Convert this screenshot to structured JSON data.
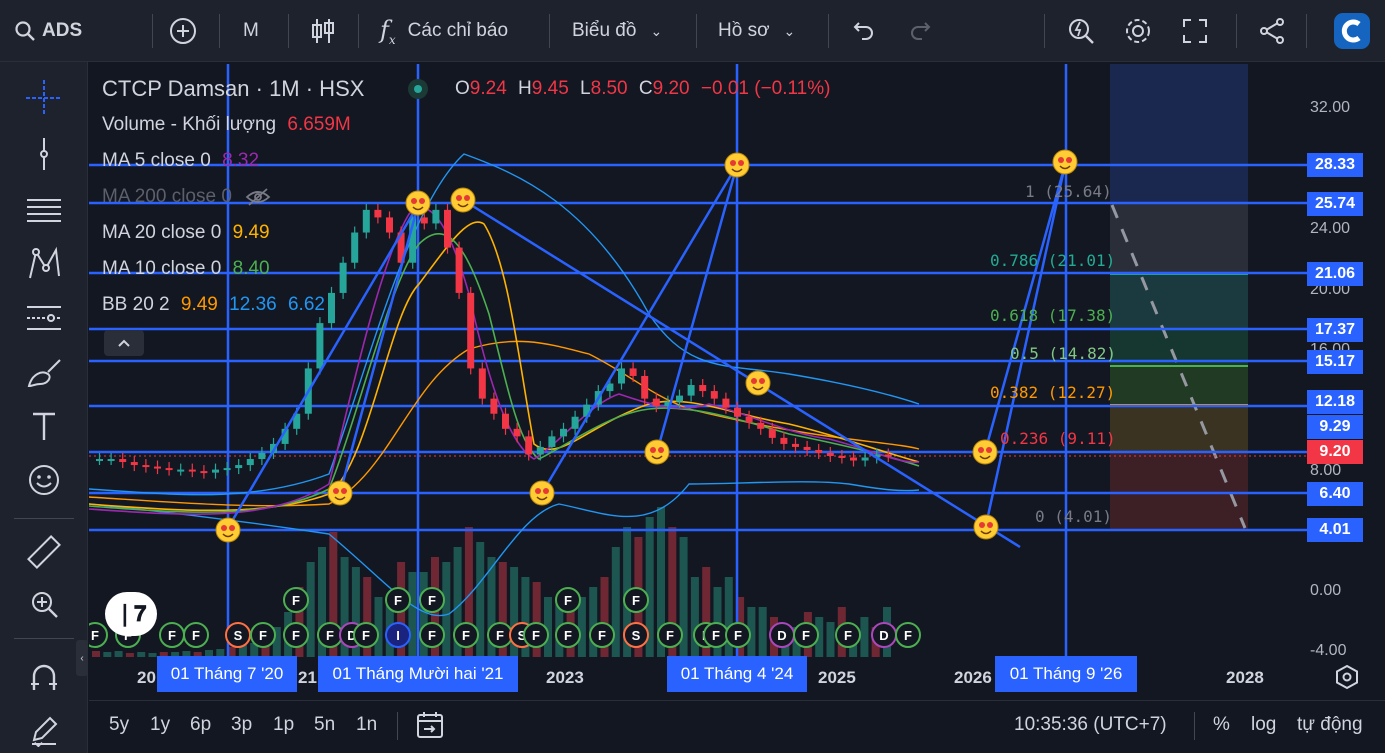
{
  "toolbar": {
    "symbol": "ADS",
    "interval": "M",
    "indicators_label": "Các chỉ báo",
    "chart_type_label": "Biểu đồ",
    "profile_label": "Hồ sơ"
  },
  "legend": {
    "title": "CTCP Damsan · 1M · HSX",
    "o_label": "O",
    "o": "9.24",
    "h_label": "H",
    "h": "9.45",
    "l_label": "L",
    "l": "8.50",
    "c_label": "C",
    "c": "9.20",
    "change": "−0.01 (−0.11%)",
    "volume_label": "Volume - Khối lượng",
    "volume": "6.659M",
    "ma5_label": "MA 5 close 0",
    "ma5": "8.32",
    "ma200_label": "MA 200 close 0",
    "ma20_label": "MA 20 close 0",
    "ma20": "9.49",
    "ma10_label": "MA 10 close 0",
    "ma10": "8.40",
    "bb_label": "BB 20 2",
    "bb1": "9.49",
    "bb2": "12.36",
    "bb3": "6.62"
  },
  "y_axis": [
    "32.00",
    "24.00",
    "20.00",
    "16.00",
    "8.00",
    "0.00",
    "-4.00"
  ],
  "price_labels": [
    {
      "v": "28.33",
      "bg": "#2962ff"
    },
    {
      "v": "25.74",
      "bg": "#2962ff"
    },
    {
      "v": "21.06",
      "bg": "#2962ff"
    },
    {
      "v": "17.37",
      "bg": "#2962ff"
    },
    {
      "v": "15.17",
      "bg": "#2962ff"
    },
    {
      "v": "12.18",
      "bg": "#2962ff"
    },
    {
      "v": "9.29",
      "bg": "#2962ff"
    },
    {
      "v": "9.20",
      "bg": "#f23645"
    },
    {
      "v": "6.40",
      "bg": "#2962ff"
    },
    {
      "v": "4.01",
      "bg": "#2962ff"
    }
  ],
  "fib_levels": [
    {
      "label": "1 (25.64)",
      "color": "#787b86"
    },
    {
      "label": "0.786 (21.01)",
      "color": "#22ab94"
    },
    {
      "label": "0.618 (17.38)",
      "color": "#4caf50"
    },
    {
      "label": "0.5 (14.82)",
      "color": "#81c784"
    },
    {
      "label": "0.382 (12.27)",
      "color": "#ff9800"
    },
    {
      "label": "0.236 (9.11)",
      "color": "#f23645"
    },
    {
      "label": "0 (4.01)",
      "color": "#787b86"
    }
  ],
  "x_axis": {
    "labels": [
      "20",
      "21",
      "2023",
      "2025",
      "2026",
      "2028"
    ],
    "highlighted": [
      "01 Tháng 7 '20",
      "01 Tháng Mười hai '21",
      "01 Tháng 4 '24",
      "01 Tháng 9 '26"
    ]
  },
  "event_markers": [
    "F",
    "S",
    "I",
    "D"
  ],
  "bottom": {
    "ranges": [
      "5y",
      "1y",
      "6p",
      "3p",
      "1p",
      "5n",
      "1n"
    ],
    "clock": "10:35:36 (UTC+7)",
    "percent": "%",
    "log": "log",
    "auto": "tự động"
  },
  "colors": {
    "up": "#26a69a",
    "down": "#f23645",
    "drawing": "#2962ff",
    "bb": "#2196f3",
    "ma5": "#9c27b0",
    "ma10": "#4caf50",
    "ma20": "#ffb300"
  }
}
